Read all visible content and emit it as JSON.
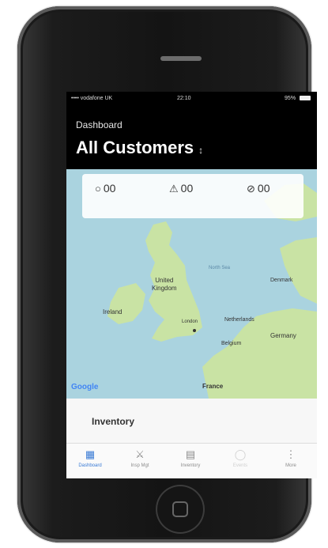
{
  "status_bar": {
    "carrier": "•••• vodafone UK",
    "time": "22:10",
    "battery": "95%"
  },
  "header": {
    "breadcrumb": "Dashboard",
    "title": "All Customers",
    "title_caret": "↕"
  },
  "stats": [
    {
      "icon": "drop-icon",
      "glyph": "○",
      "value": "00"
    },
    {
      "icon": "warning-icon",
      "glyph": "⚠",
      "value": "00"
    },
    {
      "icon": "blocked-icon",
      "glyph": "⊘",
      "value": "00"
    }
  ],
  "map": {
    "labels": {
      "uk": "United\nKingdom",
      "ireland": "Ireland",
      "london": "London",
      "north_sea": "North Sea",
      "denmark": "Denmark",
      "netherlands": "Netherlands",
      "germany": "Germany",
      "belgium": "Belgium",
      "france": "France"
    },
    "attribution": "Google"
  },
  "inventory": {
    "title": "Inventory"
  },
  "tabs": [
    {
      "label": "Dashboard",
      "icon": "grid-icon",
      "glyph": "▦",
      "state": "active"
    },
    {
      "label": "Insp Mgt",
      "icon": "inspection-icon",
      "glyph": "⚔",
      "state": "normal"
    },
    {
      "label": "Inventory",
      "icon": "inventory-icon",
      "glyph": "▤",
      "state": "normal"
    },
    {
      "label": "Events",
      "icon": "events-icon",
      "glyph": "◯",
      "state": "disabled"
    },
    {
      "label": "More",
      "icon": "more-icon",
      "glyph": "⋮",
      "state": "normal"
    }
  ],
  "colors": {
    "accent": "#3a7bd5",
    "sea": "#aad3df",
    "land": "#c9e3a4",
    "header_bg": "#000000"
  }
}
